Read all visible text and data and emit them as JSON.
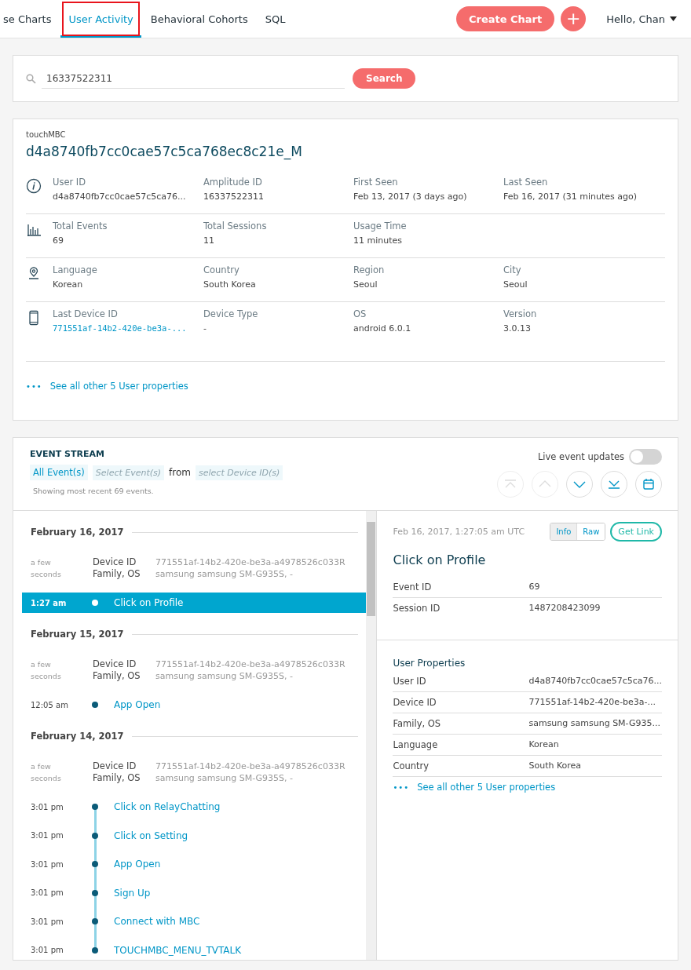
{
  "nav": {
    "tabs": [
      {
        "label": "se Charts",
        "selected": false,
        "outlined": false
      },
      {
        "label": "User Activity",
        "selected": true,
        "outlined": true
      },
      {
        "label": "Behavioral Cohorts",
        "selected": false,
        "outlined": false
      },
      {
        "label": "SQL",
        "selected": false,
        "outlined": false
      }
    ],
    "create_button": "Create Chart",
    "plus_button": "+",
    "user_menu": "Hello, Chan"
  },
  "search": {
    "value": "16337522311",
    "button": "Search"
  },
  "user": {
    "app": "touchMBC",
    "title": "d4a8740fb7cc0cae57c5ca768ec8c21e_M",
    "rows": [
      {
        "kind": "info",
        "cells": [
          {
            "label": "User ID",
            "value": "d4a8740fb7cc0cae57c5ca76...",
            "link": false
          },
          {
            "label": "Amplitude ID",
            "value": "16337522311",
            "link": false
          },
          {
            "label": "First Seen",
            "value": "Feb 13, 2017 (3 days ago)",
            "link": false
          },
          {
            "label": "Last Seen",
            "value": "Feb 16, 2017 (31 minutes ago)",
            "link": false
          }
        ]
      },
      {
        "kind": "chart",
        "cells": [
          {
            "label": "Total Events",
            "value": "69",
            "link": false
          },
          {
            "label": "Total Sessions",
            "value": "11",
            "link": false
          },
          {
            "label": "Usage Time",
            "value": "11 minutes",
            "link": false
          }
        ]
      },
      {
        "kind": "pin",
        "cells": [
          {
            "label": "Language",
            "value": "Korean",
            "link": false
          },
          {
            "label": "Country",
            "value": "South Korea",
            "link": false
          },
          {
            "label": "Region",
            "value": "Seoul",
            "link": false
          },
          {
            "label": "City",
            "value": "Seoul",
            "link": false
          }
        ]
      },
      {
        "kind": "phone",
        "cells": [
          {
            "label": "Last Device ID",
            "value": "771551af-14b2-420e-be3a-...",
            "link": true
          },
          {
            "label": "Device Type",
            "value": "-",
            "link": false
          },
          {
            "label": "OS",
            "value": "android 6.0.1",
            "link": false
          },
          {
            "label": "Version",
            "value": "3.0.13",
            "link": false
          }
        ]
      }
    ],
    "more_dots": "•••",
    "more_link": "See all other 5 User properties"
  },
  "stream": {
    "title": "EVENT STREAM",
    "filter_all": "All Event(s)",
    "filter_select_placeholder": "Select Event(s)",
    "from": "from",
    "device_placeholder": "select Device ID(s)",
    "showing": "Showing most recent 69 events.",
    "live_label": "Live event updates",
    "live_on": false,
    "nav_buttons": [
      {
        "kind": "top",
        "disabled": true
      },
      {
        "kind": "up",
        "disabled": true
      },
      {
        "kind": "down",
        "disabled": false
      },
      {
        "kind": "bottom",
        "disabled": false
      },
      {
        "kind": "calendar",
        "disabled": false
      }
    ],
    "groups": [
      {
        "date": "February 16, 2017",
        "ago": "a few seconds",
        "device_label": "Device ID",
        "device_value": "771551af-14b2-420e-be3a-a4978526c033R",
        "family_label": "Family, OS",
        "family_value": "samsung samsung SM-G935S, -",
        "events": [
          {
            "time": "1:27 am",
            "name": "Click on Profile",
            "selected": true
          }
        ]
      },
      {
        "date": "February 15, 2017",
        "ago": "a few seconds",
        "device_label": "Device ID",
        "device_value": "771551af-14b2-420e-be3a-a4978526c033R",
        "family_label": "Family, OS",
        "family_value": "samsung samsung SM-G935S, -",
        "events": [
          {
            "time": "12:05 am",
            "name": "App Open",
            "selected": false
          }
        ]
      },
      {
        "date": "February 14, 2017",
        "ago": "a few seconds",
        "device_label": "Device ID",
        "device_value": "771551af-14b2-420e-be3a-a4978526c033R",
        "family_label": "Family, OS",
        "family_value": "samsung samsung SM-G935S, -",
        "events": [
          {
            "time": "3:01 pm",
            "name": "Click on RelayChatting",
            "selected": false
          },
          {
            "time": "3:01 pm",
            "name": "Click on Setting",
            "selected": false
          },
          {
            "time": "3:01 pm",
            "name": "App Open",
            "selected": false
          },
          {
            "time": "3:01 pm",
            "name": "Sign Up",
            "selected": false
          },
          {
            "time": "3:01 pm",
            "name": "Connect with MBC",
            "selected": false
          },
          {
            "time": "3:01 pm",
            "name": "TOUCHMBC_MENU_TVTALK",
            "selected": false
          }
        ]
      }
    ],
    "detail": {
      "timestamp": "Feb 16, 2017, 1:27:05 am UTC",
      "view_tabs": [
        {
          "label": "Info",
          "selected": true
        },
        {
          "label": "Raw",
          "selected": false
        }
      ],
      "get_link": "Get Link",
      "title": "Click on Profile",
      "fields": [
        {
          "label": "Event ID",
          "value": "69"
        },
        {
          "label": "Session ID",
          "value": "1487208423099"
        }
      ],
      "props_title": "User Properties",
      "props": [
        {
          "label": "User ID",
          "value": "d4a8740fb7cc0cae57c5ca76..."
        },
        {
          "label": "Device ID",
          "value": "771551af-14b2-420e-be3a-..."
        },
        {
          "label": "Family, OS",
          "value": "samsung samsung SM-G935..."
        },
        {
          "label": "Language",
          "value": "Korean"
        },
        {
          "label": "Country",
          "value": "South Korea"
        }
      ],
      "more_dots": "•••",
      "more_link": "See all other 5 User properties"
    }
  }
}
